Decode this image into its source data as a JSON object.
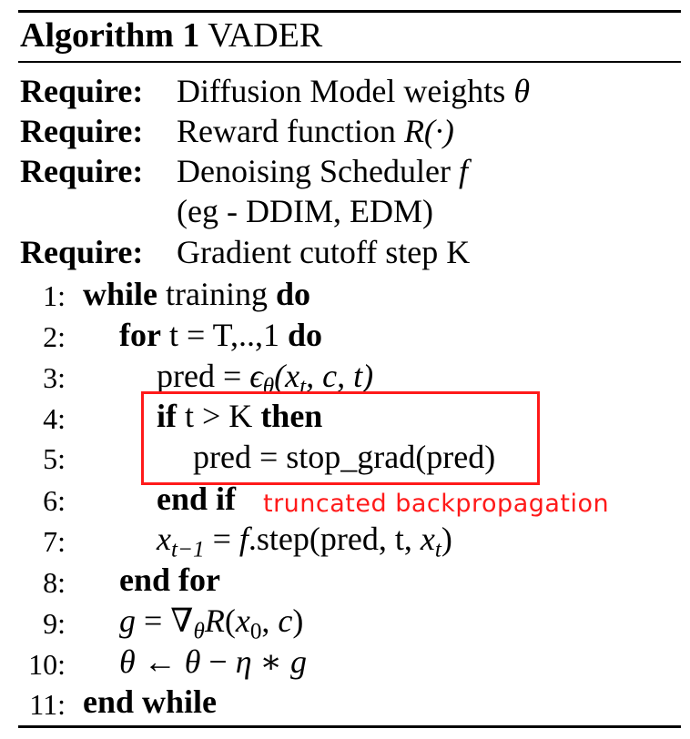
{
  "algorithm": {
    "label": "Algorithm 1",
    "name": "VADER"
  },
  "requires": [
    {
      "keyword": "Require:",
      "text": "Diffusion Model weights",
      "math": "θ"
    },
    {
      "keyword": "Require:",
      "text": "Reward function",
      "math": "R(·)"
    },
    {
      "keyword": "Require:",
      "text": "Denoising Scheduler",
      "math": "f"
    },
    {
      "keyword": "",
      "text": "(eg - DDIM, EDM)",
      "math": ""
    },
    {
      "keyword": "Require:",
      "text": "Gradient cutoff step K",
      "math": ""
    }
  ],
  "lines": [
    {
      "num": "1:",
      "kw1": "while",
      "text": " training ",
      "kw2": "do"
    },
    {
      "num": "2:",
      "kw1": "for",
      "text": " t = T,..,1 ",
      "kw2": "do"
    },
    {
      "num": "3:",
      "text": "pred = ",
      "math": "ϵ",
      "math_sub": "θ",
      "math_rest": "(x",
      "math_sub2": "t",
      "math_end": ", c, t)"
    },
    {
      "num": "4:",
      "kw1": "if",
      "text": " t > K ",
      "kw2": "then"
    },
    {
      "num": "5:",
      "text": "pred = stop_grad(pred)"
    },
    {
      "num": "6:",
      "kw1": "end if"
    },
    {
      "num": "7:",
      "math_a": "x",
      "math_a_sub": "t−1",
      "text_a": " = ",
      "math_b": "f",
      "text_b": ".step(pred, t, ",
      "math_c": "x",
      "math_c_sub": "t",
      "text_c": ")"
    },
    {
      "num": "8:",
      "kw1": "end for"
    },
    {
      "num": "9:",
      "math_a": "g",
      "text_a": " = ∇",
      "math_sub": "θ",
      "math_b": "R",
      "text_b": "(",
      "math_c": "x",
      "math_c_sub": "0",
      "text_c": ", ",
      "math_d": "c",
      "text_d": ")"
    },
    {
      "num": "10:",
      "math_a": "θ",
      "text_a": " ← ",
      "math_b": "θ",
      "text_b": " − ",
      "math_c": "η",
      "text_c": " ∗ ",
      "math_d": "g"
    },
    {
      "num": "11:",
      "kw1": "end while"
    }
  ],
  "annotation": {
    "label": "truncated backpropagation",
    "color": "#ff1a1a"
  }
}
